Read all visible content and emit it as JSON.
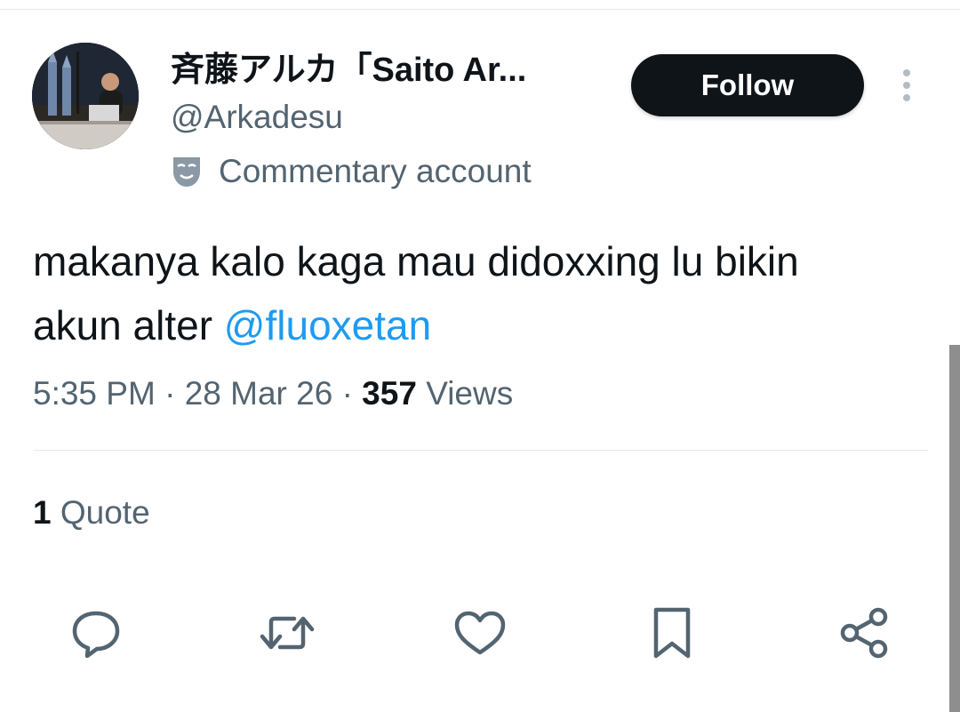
{
  "tweet": {
    "author": {
      "display_name": "斉藤アルカ「Saito Ar...",
      "handle": "@Arkadesu",
      "label": "Commentary account",
      "label_icon": "theater-mask-icon",
      "avatar_icon": "avatar-photo"
    },
    "follow_label": "Follow",
    "text_before_mention": "makanya kalo kaga mau didoxxing lu bikin akun alter ",
    "mention": "@fluoxetan",
    "time": "5:35 PM",
    "separator": "·",
    "date": "28 Mar 26",
    "views_count": "357",
    "views_label": "Views",
    "quote_count": "1",
    "quote_label": "Quote"
  },
  "actions": [
    {
      "icon": "reply-icon"
    },
    {
      "icon": "retweet-icon"
    },
    {
      "icon": "like-icon"
    },
    {
      "icon": "bookmark-icon"
    },
    {
      "icon": "share-icon"
    }
  ],
  "colors": {
    "text_primary": "#0f1419",
    "text_secondary": "#536471",
    "link": "#1d9bf0",
    "follow_bg": "#0f1419",
    "divider": "#e7e9ea"
  }
}
